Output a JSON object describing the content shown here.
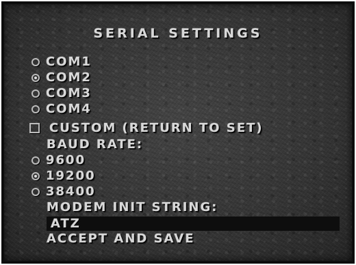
{
  "menu": {
    "title": "SERIAL SETTINGS",
    "ports": [
      {
        "label": "COM1",
        "selected": false
      },
      {
        "label": "COM2",
        "selected": true
      },
      {
        "label": "COM3",
        "selected": false
      },
      {
        "label": "COM4",
        "selected": false
      }
    ],
    "custom": {
      "label": "CUSTOM (RETURN TO SET)",
      "checked": false
    },
    "baud_heading": "BAUD RATE:",
    "baud_rates": [
      {
        "label": "9600",
        "selected": false
      },
      {
        "label": "19200",
        "selected": true
      },
      {
        "label": "38400",
        "selected": false
      }
    ],
    "init_heading": "MODEM INIT STRING:",
    "init_value": "ATZ",
    "accept_label": "ACCEPT AND SAVE"
  },
  "colors": {
    "text": "#d8d8d8",
    "panel": "#353535",
    "field": "#0e0e0e"
  }
}
